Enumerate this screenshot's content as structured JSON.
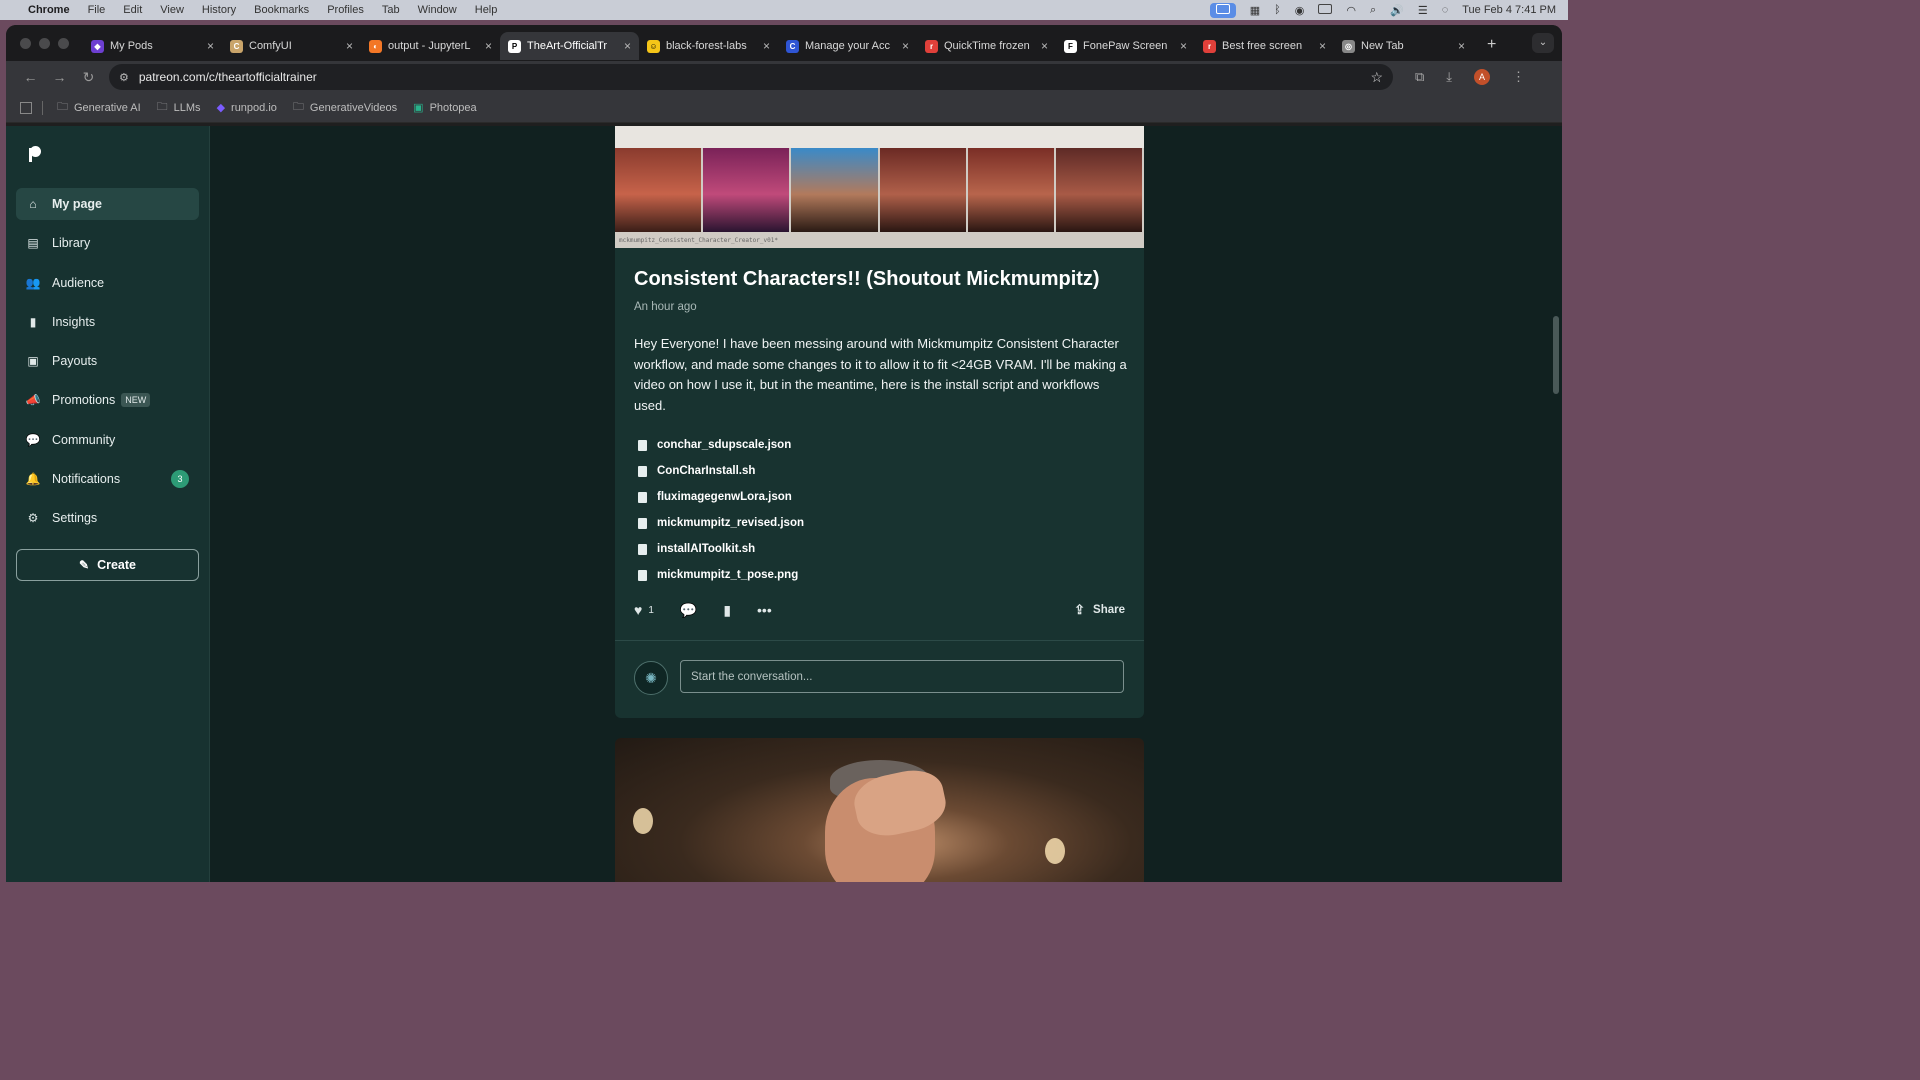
{
  "menubar": {
    "app": "Chrome",
    "items": [
      "File",
      "Edit",
      "View",
      "History",
      "Bookmarks",
      "Profiles",
      "Tab",
      "Window",
      "Help"
    ],
    "datetime": "Tue Feb 4  7:41 PM"
  },
  "tabs": [
    {
      "title": "My Pods",
      "color": "#6d3fd1",
      "glyph": "◆"
    },
    {
      "title": "ComfyUI",
      "color": "#c9a46a",
      "glyph": "C"
    },
    {
      "title": "output - JupyterL",
      "color": "#f37726",
      "glyph": "◐"
    },
    {
      "title": "TheArt-OfficialTr",
      "color": "#ffffff",
      "glyph": "P",
      "active": true
    },
    {
      "title": "black-forest-labs",
      "color": "#f5c518",
      "glyph": "☺"
    },
    {
      "title": "Manage your Acc",
      "color": "#2f55d4",
      "glyph": "C"
    },
    {
      "title": "QuickTime frozen",
      "color": "#e0403a",
      "glyph": "r"
    },
    {
      "title": "FonePaw Screen",
      "color": "#ffffff",
      "glyph": "F"
    },
    {
      "title": "Best free screen",
      "color": "#e0403a",
      "glyph": "r"
    },
    {
      "title": "New Tab",
      "color": "#888888",
      "glyph": "◎"
    }
  ],
  "address": {
    "url": "patreon.com/c/theartofficialtrainer"
  },
  "bookmarks": [
    {
      "label": "Generative AI",
      "icon": "folder-icon"
    },
    {
      "label": "LLMs",
      "icon": "folder-icon"
    },
    {
      "label": "runpod.io",
      "icon": "runpod-icon"
    },
    {
      "label": "GenerativeVideos",
      "icon": "folder-icon"
    },
    {
      "label": "Photopea",
      "icon": "photopea-icon"
    }
  ],
  "sidebar": {
    "items": [
      {
        "label": "My page",
        "icon": "home-icon",
        "glyph": "⌂",
        "active": true
      },
      {
        "label": "Library",
        "icon": "library-icon",
        "glyph": "▤"
      },
      {
        "label": "Audience",
        "icon": "audience-icon",
        "glyph": "👥"
      },
      {
        "label": "Insights",
        "icon": "insights-icon",
        "glyph": "▮"
      },
      {
        "label": "Payouts",
        "icon": "payouts-icon",
        "glyph": "▣"
      },
      {
        "label": "Promotions",
        "icon": "megaphone-icon",
        "glyph": "📣",
        "badge": "NEW"
      },
      {
        "label": "Community",
        "icon": "community-icon",
        "glyph": "💬"
      },
      {
        "label": "Notifications",
        "icon": "bell-icon",
        "glyph": "🔔",
        "count": "3"
      },
      {
        "label": "Settings",
        "icon": "gear-icon",
        "glyph": "⚙"
      }
    ],
    "create_label": "Create"
  },
  "post": {
    "image_caption": "mckmumpitz_Consistent_Character_Creator_v01*",
    "title": "Consistent Characters!! (Shoutout Mickmumpitz)",
    "time": "An hour ago",
    "body": "Hey Everyone! I have been messing around with Mickmumpitz Consistent Character workflow, and made some changes to it to allow it to fit <24GB VRAM. I'll be making a video on how I use it, but in the meantime, here is the install script and workflows used.",
    "files": [
      "conchar_sdupscale.json",
      "ConCharInstall.sh",
      "fluximagegenwLora.json",
      "mickmumpitz_revised.json",
      "installAIToolkit.sh",
      "mickmumpitz_t_pose.png"
    ],
    "like_count": "1",
    "share_label": "Share",
    "comment_placeholder": "Start the conversation..."
  }
}
